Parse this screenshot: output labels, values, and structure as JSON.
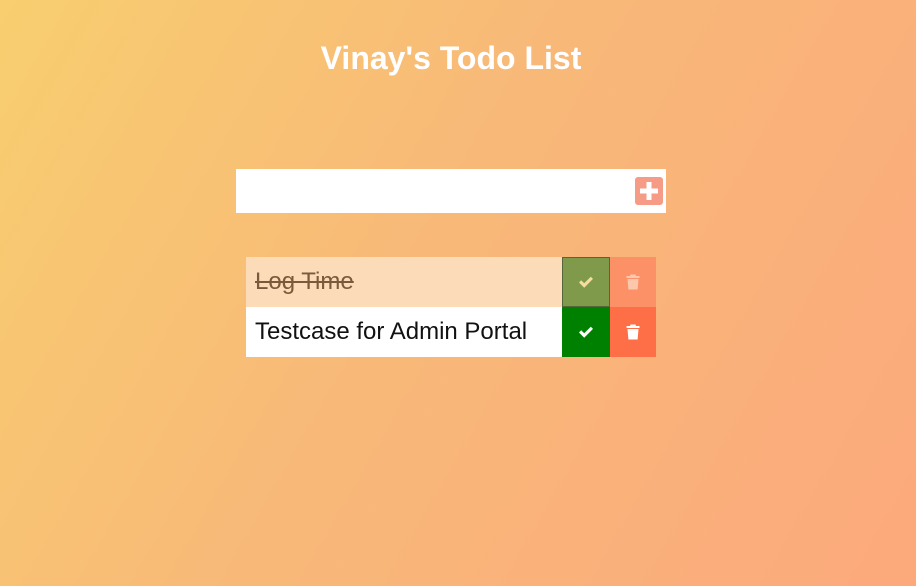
{
  "header": {
    "title": "Vinay's Todo List"
  },
  "form": {
    "input_value": "",
    "add_icon": "plus-square-icon",
    "add_color": "#f59b86"
  },
  "todos": [
    {
      "text": "Log Time",
      "completed": true
    },
    {
      "text": "Testcase for Admin Portal",
      "completed": false
    }
  ],
  "colors": {
    "complete": "#008000",
    "trash": "#ff6f47",
    "completed_row_bg": "#fbdbb8"
  },
  "icons": {
    "complete": "check-icon",
    "trash": "trash-icon"
  }
}
